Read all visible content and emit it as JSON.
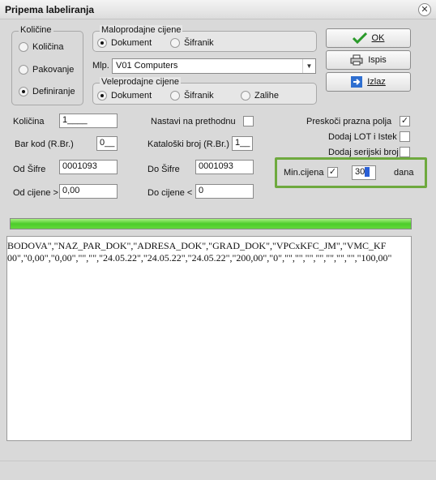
{
  "window": {
    "title": "Pripema labeliranja",
    "close_icon": "close-icon"
  },
  "kolicine": {
    "legend": "Količine",
    "options": [
      {
        "label": "Količina",
        "selected": false
      },
      {
        "label": "Pakovanje",
        "selected": false
      },
      {
        "label": "Definiranje",
        "selected": true
      }
    ]
  },
  "maloprodajne": {
    "legend": "Maloprodajne cijene",
    "options": [
      {
        "label": "Dokument",
        "selected": true
      },
      {
        "label": "Šifranik",
        "selected": false
      }
    ],
    "mlp_label": "Mlp.",
    "mlp_value": "V01 Computers"
  },
  "veleprodajne": {
    "legend": "Veleprodajne cijene",
    "options": [
      {
        "label": "Dokument",
        "selected": true
      },
      {
        "label": "Šifranik",
        "selected": false
      },
      {
        "label": "Zalihe",
        "selected": false
      }
    ]
  },
  "buttons": {
    "ok": "OK",
    "ispis": "Ispis",
    "izlaz": "Izlaz"
  },
  "form": {
    "kolicina": {
      "label": "Količina",
      "value": "1____"
    },
    "bar_kod": {
      "label": "Bar kod (R.Br.)",
      "value": "0__"
    },
    "od_sifre": {
      "label": "Od Šifre",
      "value": "0001093"
    },
    "od_cijene": {
      "label": "Od cijene >",
      "value": "0,00"
    },
    "nastavi": {
      "label": "Nastavi na prethodnu",
      "checked": false
    },
    "katalog": {
      "label": "Kataloški broj (R.Br.)",
      "value": "1__"
    },
    "do_sifre": {
      "label": "Do Šifre",
      "value": "0001093"
    },
    "do_cijene": {
      "label": "Do cijene <",
      "value": "0"
    },
    "preskoci": {
      "label": "Preskoči prazna polja",
      "checked": true
    },
    "lot": {
      "label": "Dodaj LOT i Istek",
      "checked": false
    },
    "serijski": {
      "label": "Dodaj serijski broj",
      "checked": false
    },
    "min_cijena": {
      "label": "Min.cijena",
      "checked": true,
      "days": "30",
      "unit": "dana"
    }
  },
  "progress": {
    "percent": 100,
    "color": "#4ccc2a"
  },
  "output": {
    "lines": [
      "BODOVA\",\"NAZ_PAR_DOK\",\"ADRESA_DOK\",\"GRAD_DOK\",\"VPCxKFC_JM\",\"VMC_KF",
      "00\",\"0,00\",\"0,00\",\"\",\"\",\"24.05.22\",\"24.05.22\",\"24.05.22\",\"200,00\",\"0\",\"\",\"\",\"\",\"\",\"\",\"\",\"\",\"100,00\""
    ]
  },
  "colors": {
    "highlight": "#6ea93e",
    "ok_check": "#2a9a2a",
    "izlaz_icon": "#2f6fd0"
  }
}
